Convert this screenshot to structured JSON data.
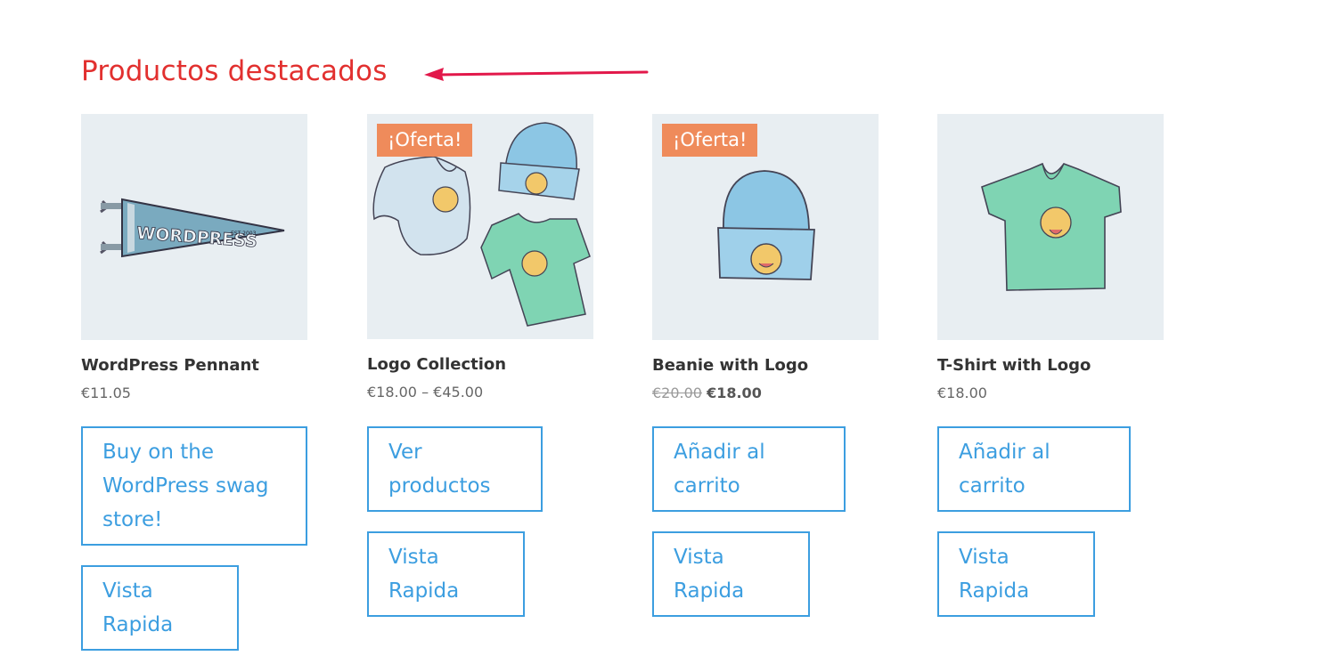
{
  "section": {
    "title": "Productos destacados",
    "title_color": "#e2302f",
    "arrow_color": "#e2184a"
  },
  "colors": {
    "accent": "#3c9ee0",
    "sale_badge": "#ef8b5b",
    "thumb_bg": "#e8eef2"
  },
  "products": [
    {
      "name": "WordPress Pennant",
      "price": "€11.05",
      "image_icon": "wordpress-pennant-image",
      "primary_button": "Buy on the WordPress swag store!",
      "quick_view": "Vista Rapida"
    },
    {
      "name": "Logo Collection",
      "price": "€18.00 – €45.00",
      "sale_badge": "¡Oferta!",
      "image_icon": "logo-collection-image",
      "primary_button": "Ver productos",
      "quick_view": "Vista Rapida"
    },
    {
      "name": "Beanie with Logo",
      "price_regular": "€20.00",
      "price_sale": "€18.00",
      "sale_badge": "¡Oferta!",
      "image_icon": "beanie-image",
      "primary_button": "Añadir al carrito",
      "quick_view": "Vista Rapida"
    },
    {
      "name": "T-Shirt with Logo",
      "price": "€18.00",
      "image_icon": "tshirt-image",
      "primary_button": "Añadir al carrito",
      "quick_view": "Vista Rapida"
    }
  ]
}
